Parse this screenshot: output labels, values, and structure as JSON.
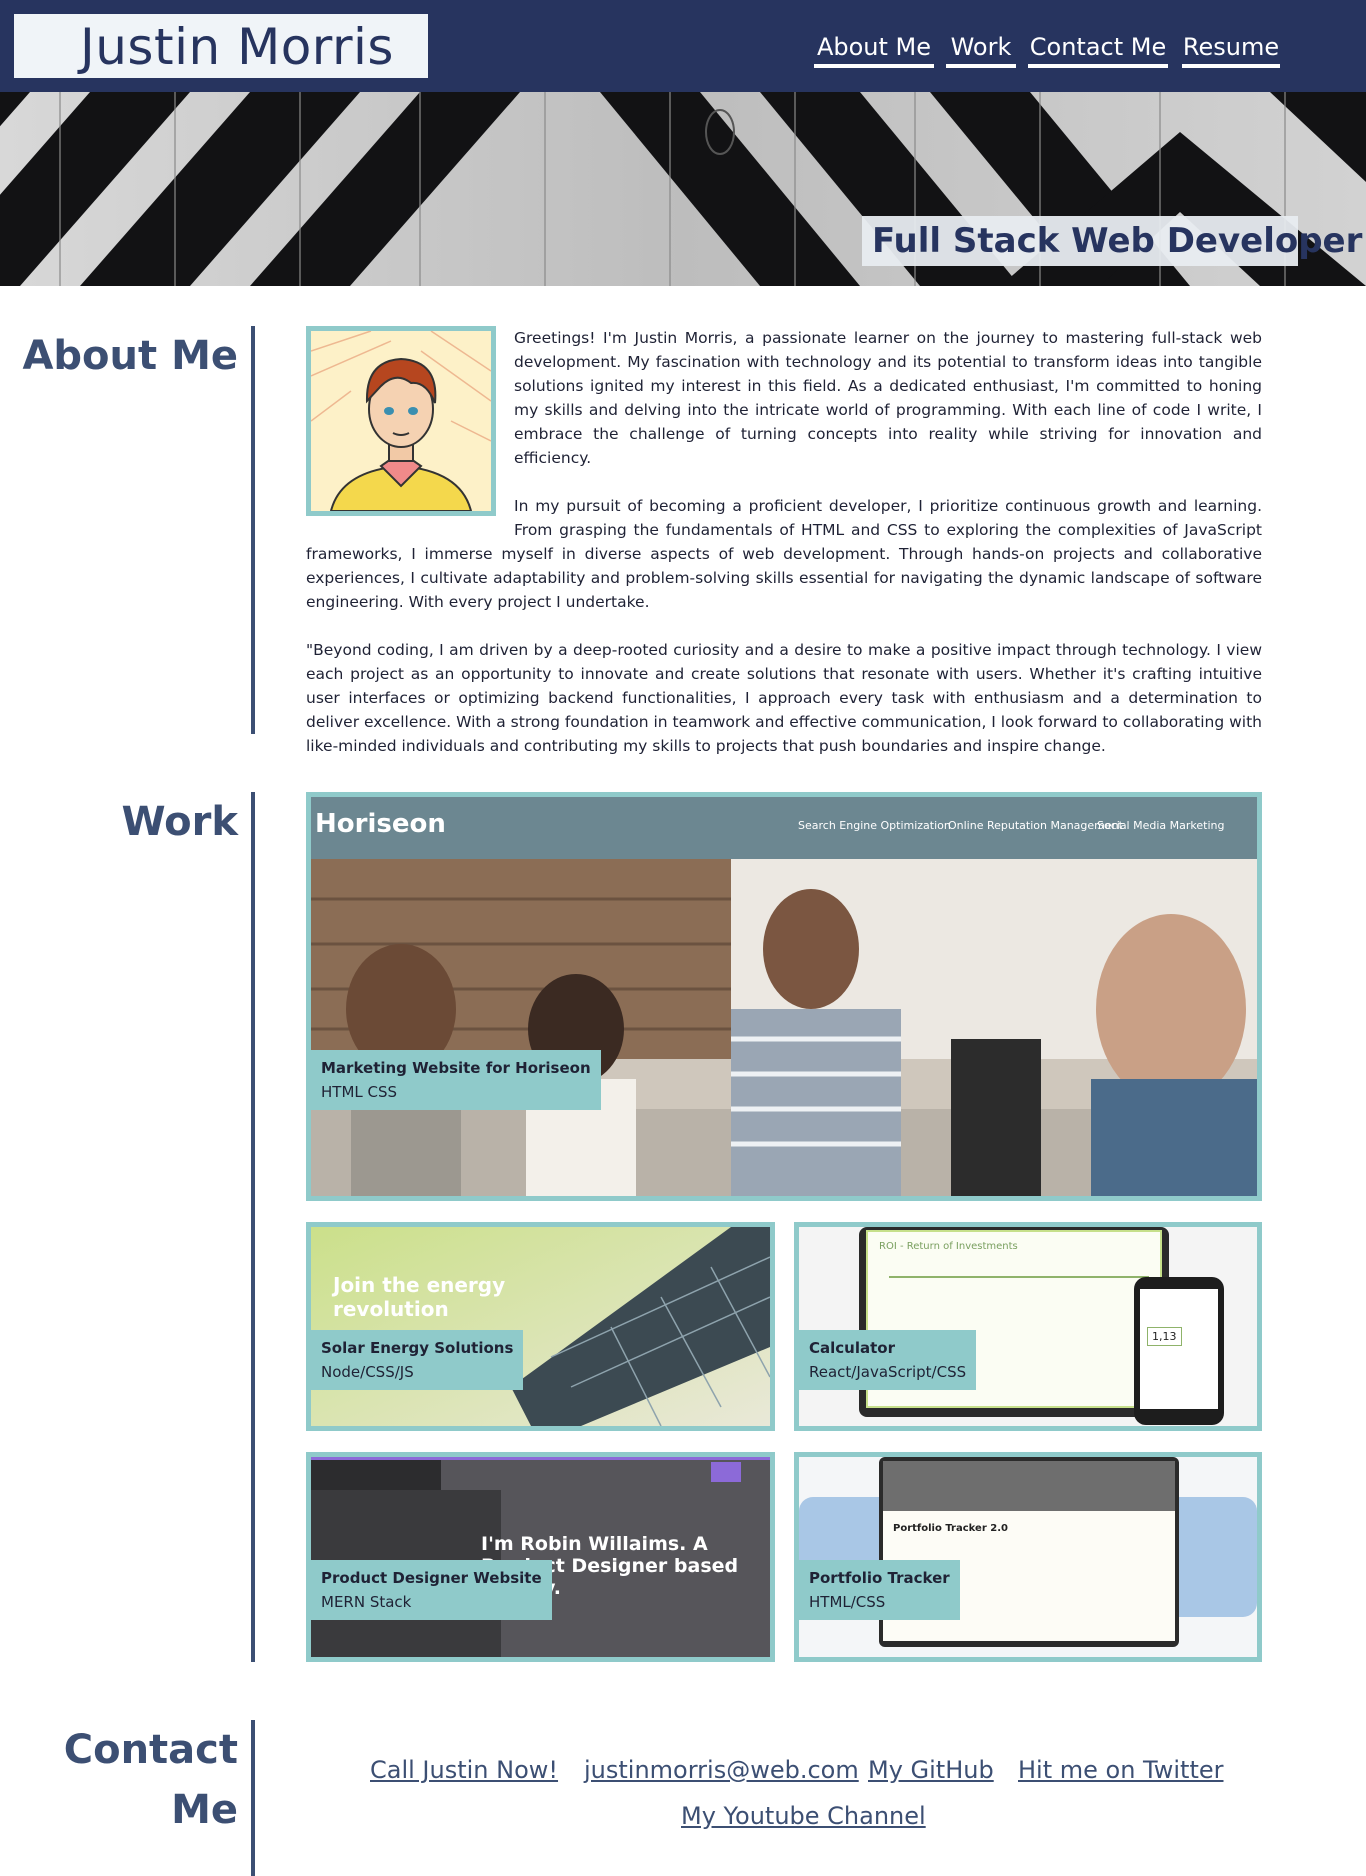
{
  "header": {
    "name": "Justin Morris",
    "nav": [
      {
        "label": "About Me"
      },
      {
        "label": "Work"
      },
      {
        "label": "Contact Me"
      },
      {
        "label": "Resume"
      }
    ]
  },
  "hero": {
    "tagline": "Full Stack Web Developer"
  },
  "about": {
    "title": "About Me",
    "paragraphs": [
      "Greetings! I'm Justin Morris, a passionate learner on the journey to mastering full-stack web development. My fascination with technology and its potential to transform ideas into tangible solutions ignited my interest in this field. As a dedicated enthusiast, I'm committed to honing my skills and delving into the intricate world of programming. With each line of code I write, I embrace the challenge of turning concepts into reality while striving for innovation and efficiency.",
      "In my pursuit of becoming a proficient developer, I prioritize continuous growth and learning. From grasping the fundamentals of HTML and CSS to exploring the complexities of JavaScript frameworks, I immerse myself in diverse aspects of web development. Through hands-on projects and collaborative experiences, I cultivate adaptability and problem-solving skills essential for navigating the dynamic landscape of software engineering. With every project I undertake.",
      "\"Beyond coding, I am driven by a deep-rooted curiosity and a desire to make a positive impact through technology. I view each project as an opportunity to innovate and create solutions that resonate with users. Whether it's crafting intuitive user interfaces or optimizing backend functionalities, I approach every task with enthusiasm and a determination to deliver excellence. With a strong foundation in teamwork and effective communication, I look forward to collaborating with like-minded individuals and contributing my skills to projects that push boundaries and inspire change."
    ]
  },
  "work": {
    "title": "Work",
    "projects": [
      {
        "title": "Marketing Website for Horiseon",
        "tech": "HTML CSS",
        "preview": {
          "brand": "Horiseon",
          "nav": [
            "Search Engine Optimization",
            "Online Reputation Management",
            "Social Media Marketing"
          ]
        }
      },
      {
        "title": "Solar Energy Solutions",
        "tech": "Node/CSS/JS",
        "preview": {
          "headline": "Join the energy revolution"
        }
      },
      {
        "title": "Calculator",
        "tech": "React/JavaScript/CSS",
        "preview": {
          "heading": "ROI - Return of Investments",
          "result": "1,13"
        }
      },
      {
        "title": "Product Designer Website",
        "tech": "MERN Stack",
        "preview": {
          "headline": "I'm Robin Willaims. A Product Designer based in Italy."
        }
      },
      {
        "title": "Portfolio Tracker",
        "tech": "HTML/CSS",
        "preview": {
          "heading": "Portfolio Tracker 2.0"
        }
      }
    ]
  },
  "contact": {
    "title_line1": "Contact",
    "title_line2": "Me",
    "links": [
      {
        "label": "Call Justin Now!"
      },
      {
        "label": "justinmorris@web.com"
      },
      {
        "label": "My GitHub"
      },
      {
        "label": "Hit me on Twitter"
      },
      {
        "label": "My Youtube Channel"
      }
    ]
  }
}
